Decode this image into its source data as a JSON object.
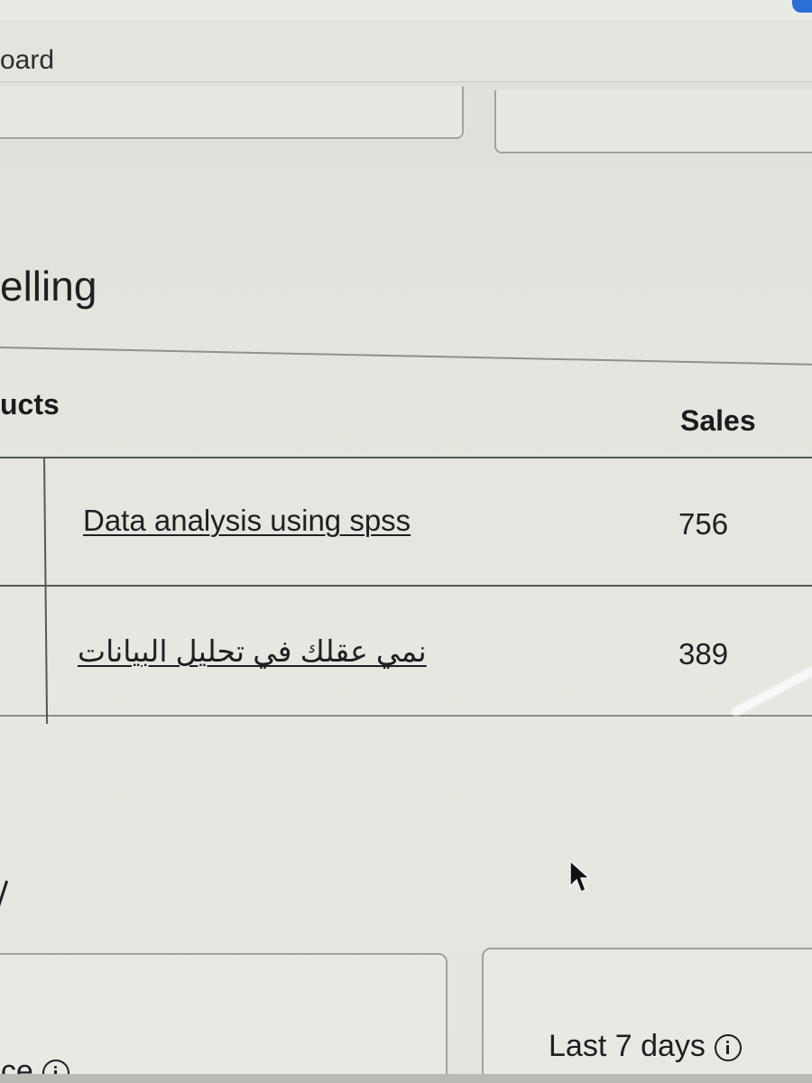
{
  "header": {
    "breadcrumb": "oard"
  },
  "best_selling": {
    "title": "elling",
    "columns": {
      "products": "ucts",
      "sales": "Sales"
    },
    "rows": [
      {
        "product": "Data analysis using spss",
        "sales": "756"
      },
      {
        "product": "نمي عقلك في تحليل البيانات",
        "sales": "389"
      }
    ]
  },
  "bottom_cards": {
    "left_label": "nce",
    "right_label": "Last 7 days"
  },
  "icons": {
    "info": "info-icon",
    "cursor": "cursor-arrow-icon"
  }
}
